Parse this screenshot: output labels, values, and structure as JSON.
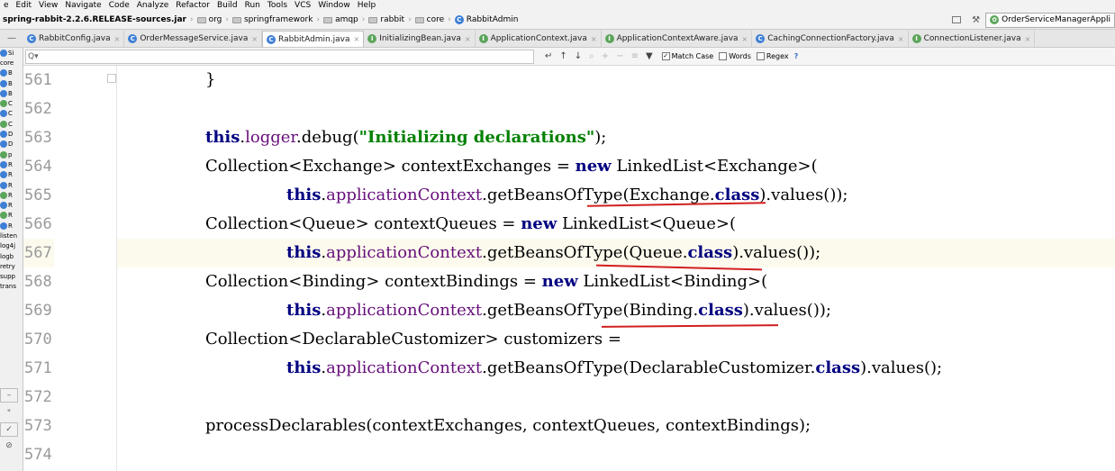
{
  "menu": [
    "e",
    "Edit",
    "View",
    "Navigate",
    "Code",
    "Analyze",
    "Refactor",
    "Build",
    "Run",
    "Tools",
    "VCS",
    "Window",
    "Help"
  ],
  "breadcrumbs": [
    {
      "label": "spring-rabbit-2.2.6.RELEASE-sources.jar",
      "icon": "jar"
    },
    {
      "label": "org",
      "icon": "folder-icon"
    },
    {
      "label": "springframework",
      "icon": "folder-icon"
    },
    {
      "label": "amqp",
      "icon": "folder-icon"
    },
    {
      "label": "rabbit",
      "icon": "folder-icon"
    },
    {
      "label": "core",
      "icon": "folder-icon"
    },
    {
      "label": "RabbitAdmin",
      "icon": "class-icon"
    }
  ],
  "run_config": "OrderServiceManagerAppli",
  "tabs": [
    {
      "label": "RabbitConfig.java",
      "icon": "C"
    },
    {
      "label": "OrderMessageService.java",
      "icon": "C"
    },
    {
      "label": "RabbitAdmin.java",
      "icon": "C",
      "active": true
    },
    {
      "label": "InitializingBean.java",
      "icon": "I"
    },
    {
      "label": "ApplicationContext.java",
      "icon": "I"
    },
    {
      "label": "ApplicationContextAware.java",
      "icon": "I"
    },
    {
      "label": "CachingConnectionFactory.java",
      "icon": "C"
    },
    {
      "label": "ConnectionListener.java",
      "icon": "I"
    }
  ],
  "project_strip": [
    "Si",
    "core",
    "B",
    "B",
    "B",
    "C",
    "C",
    "C",
    "D",
    "D",
    "p",
    "R",
    "R",
    "R",
    "R",
    "R",
    "R",
    "R",
    "listen",
    "log4j",
    "logb",
    "retry",
    "supp",
    "trans"
  ],
  "search": {
    "value": "",
    "placeholder": "Q▾",
    "match_case_label": "Match Case",
    "match_case": true,
    "words_label": "Words",
    "words": false,
    "regex_label": "Regex",
    "regex": false,
    "help": "?"
  },
  "gutter_markers": [
    "–",
    "\"",
    "✓",
    "⊘"
  ],
  "code_lines": [
    {
      "num": "561",
      "code": "}"
    },
    {
      "num": "562",
      "code": ""
    },
    {
      "num": "563",
      "code": "this.logger.debug(\"Initializing declarations\");"
    },
    {
      "num": "564",
      "code": "Collection<Exchange> contextExchanges = new LinkedList<Exchange>("
    },
    {
      "num": "565",
      "code": "this.applicationContext.getBeansOfType(Exchange.class).values());"
    },
    {
      "num": "566",
      "code": "Collection<Queue> contextQueues = new LinkedList<Queue>("
    },
    {
      "num": "567",
      "code": "this.applicationContext.getBeansOfType(Queue.class).values());"
    },
    {
      "num": "568",
      "code": "Collection<Binding> contextBindings = new LinkedList<Binding>("
    },
    {
      "num": "569",
      "code": "this.applicationContext.getBeansOfType(Binding.class).values());"
    },
    {
      "num": "570",
      "code": "Collection<DeclarableCustomizer> customizers ="
    },
    {
      "num": "571",
      "code": "this.applicationContext.getBeansOfType(DeclarableCustomizer.class).values();"
    },
    {
      "num": "572",
      "code": ""
    },
    {
      "num": "573",
      "code": "processDeclarables(contextExchanges, contextQueues, contextBindings);"
    },
    {
      "num": "574",
      "code": ""
    }
  ],
  "colors": {
    "keyword": "#000080",
    "field": "#660e7a",
    "string": "#008000",
    "current_line": "#fcfaed",
    "annotation_underline": "#d21f1f"
  }
}
